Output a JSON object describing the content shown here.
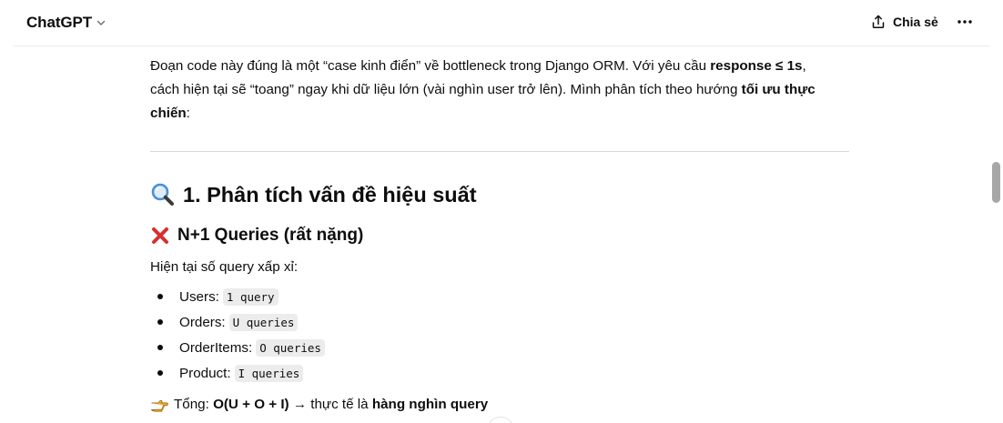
{
  "header": {
    "model_name": "ChatGPT",
    "share_label": "Chia sẻ"
  },
  "message": {
    "p1_a": "Đoạn code này đúng là một “case kinh điển” về bottleneck trong Django ORM. Với yêu cầu ",
    "p1_b": "response ≤ 1s",
    "p1_c": ",",
    "p2_a": "cách hiện tại sẽ “toang” ngay khi dữ liệu lớn (vài nghìn user trở lên). Mình phân tích theo hướng ",
    "p2_b": "tối ưu thực",
    "p3_a": "chiến",
    "p3_b": ":",
    "h2": "1. Phân tích vấn đề hiệu suất",
    "h3": "N+1 Queries (rất nặng)",
    "intro": "Hiện tại số query xấp xỉ:",
    "items": [
      {
        "label": "Users:",
        "code": "1 query"
      },
      {
        "label": "Orders:",
        "code": "U queries"
      },
      {
        "label": "OrderItems:",
        "code": "O queries"
      },
      {
        "label": "Product:",
        "code": "I queries"
      }
    ],
    "summary_a": "Tổng: ",
    "summary_b": "O(U + O + I)",
    "summary_c": " → thực tế là ",
    "summary_d": "hàng nghìn query"
  },
  "colors": {
    "text": "#0d0d0d",
    "code_bg": "#ececec",
    "divider": "#d9d9d9",
    "scroll_thumb": "#a7a7a7",
    "cross_icon": "#d63031",
    "magnifier_icon": "#4a90d9",
    "hand_icon": "#f5b83d"
  },
  "icons": [
    "chevron-down-icon",
    "share-icon",
    "more-icon",
    "magnifier-icon",
    "cross-mark-icon",
    "pointing-hand-icon"
  ]
}
